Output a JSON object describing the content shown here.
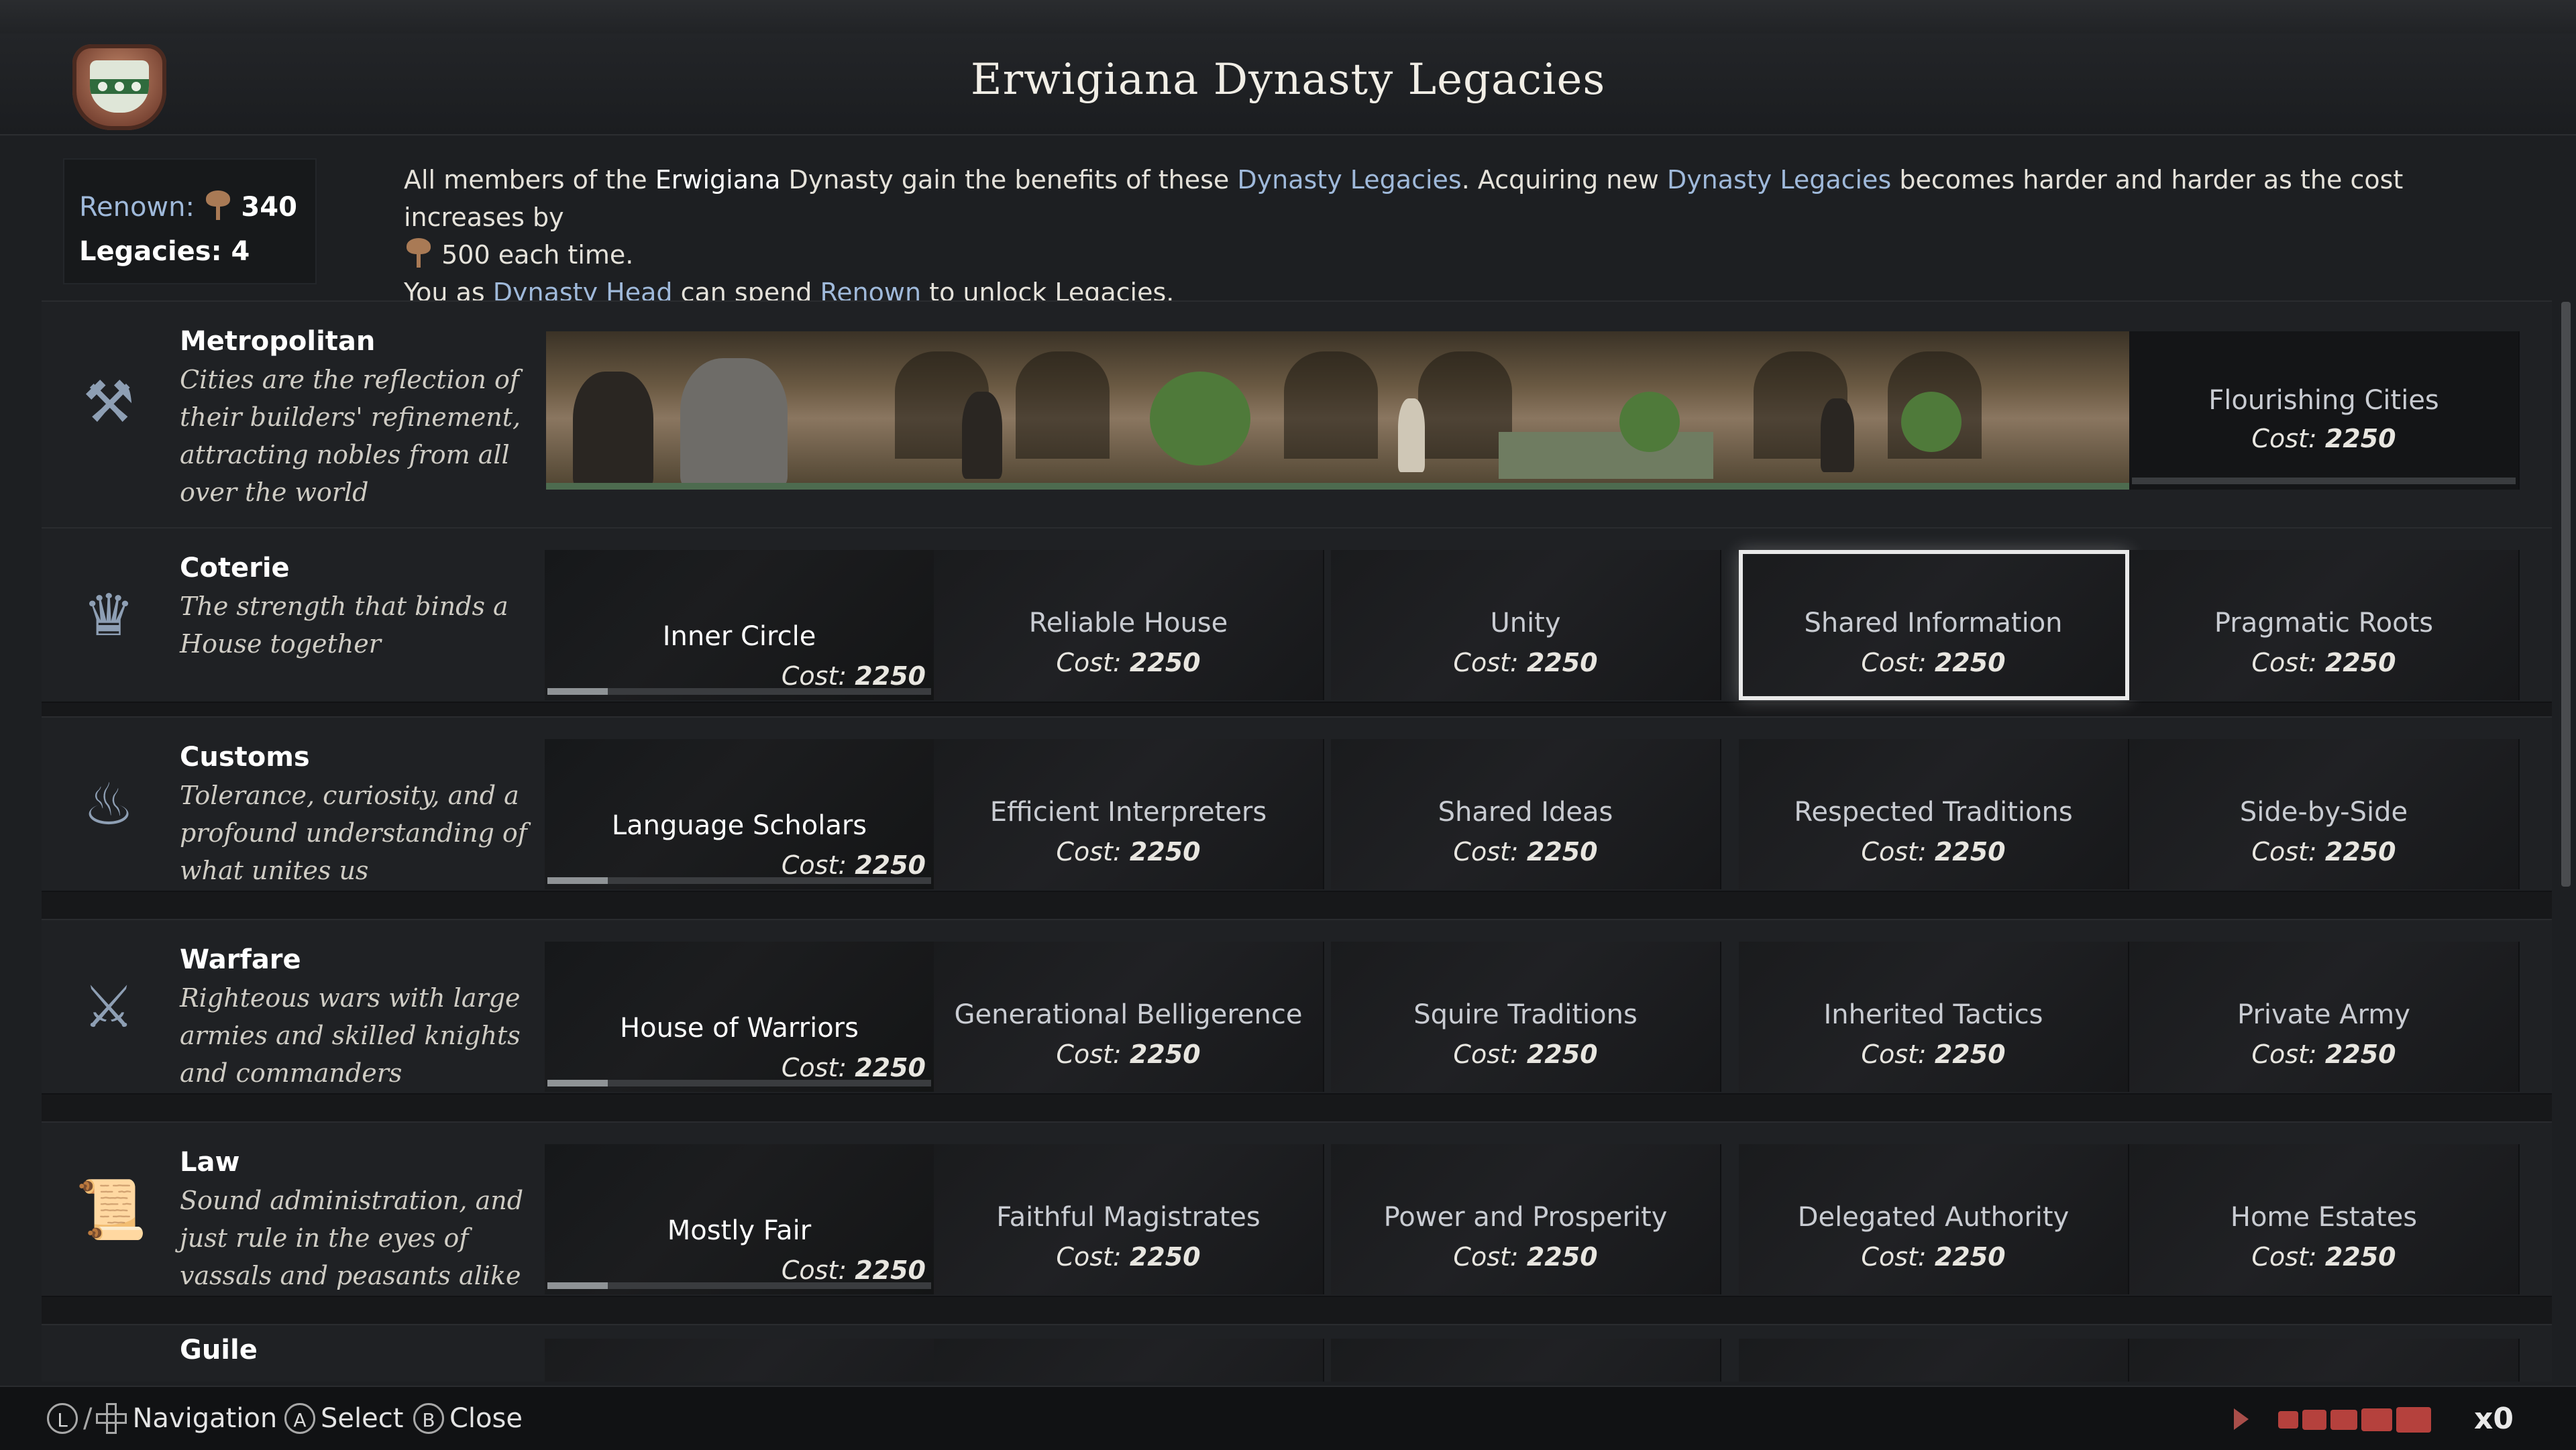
{
  "window": {
    "title": "Erwigiana Dynasty Legacies"
  },
  "summary": {
    "renown_label": "Renown:",
    "renown_value": "340",
    "legacies_text": "Legacies: 4"
  },
  "description": {
    "line1_a": "All members of the ",
    "line1_dynasty": "Erwigiana",
    "line1_b": " Dynasty gain the benefits of these ",
    "line1_link1": "Dynasty Legacies",
    "line1_c": ". Acquiring new ",
    "line1_link2": "Dynasty Legacies",
    "line1_d": " becomes harder and harder as the cost increases by",
    "line2": "500 each time.",
    "line3_a": "You as ",
    "line3_link1": "Dynasty Head",
    "line3_b": " can spend ",
    "line3_link2": "Renown",
    "line3_c": " to unlock Legacies."
  },
  "tracks": [
    {
      "name": "Metropolitan",
      "description": "Cities are the reflection of their builders' refinement, attracting nobles from all over the world",
      "icon": "hammer-icon",
      "legacies": [
        {
          "name": "Flourishing Cities",
          "cost_label": "Cost:",
          "cost": "2250"
        }
      ]
    },
    {
      "name": "Coterie",
      "description": "The strength that binds a House together",
      "icon": "crowns-icon",
      "legacies": [
        {
          "name": "Inner Circle",
          "cost_label": "Cost:",
          "cost": "2250"
        },
        {
          "name": "Reliable House",
          "cost_label": "Cost:",
          "cost": "2250"
        },
        {
          "name": "Unity",
          "cost_label": "Cost:",
          "cost": "2250"
        },
        {
          "name": "Shared Information",
          "cost_label": "Cost:",
          "cost": "2250"
        },
        {
          "name": "Pragmatic Roots",
          "cost_label": "Cost:",
          "cost": "2250"
        }
      ]
    },
    {
      "name": "Customs",
      "description": "Tolerance, curiosity, and a profound understanding of what unites us",
      "icon": "flame-icon",
      "legacies": [
        {
          "name": "Language Scholars",
          "cost_label": "Cost:",
          "cost": "2250"
        },
        {
          "name": "Efficient Interpreters",
          "cost_label": "Cost:",
          "cost": "2250"
        },
        {
          "name": "Shared Ideas",
          "cost_label": "Cost:",
          "cost": "2250"
        },
        {
          "name": "Respected Traditions",
          "cost_label": "Cost:",
          "cost": "2250"
        },
        {
          "name": "Side-by-Side",
          "cost_label": "Cost:",
          "cost": "2250"
        }
      ]
    },
    {
      "name": "Warfare",
      "description": "Righteous wars with large armies and skilled knights and commanders",
      "icon": "crossed-swords-icon",
      "legacies": [
        {
          "name": "House of Warriors",
          "cost_label": "Cost:",
          "cost": "2250"
        },
        {
          "name": "Generational Belligerence",
          "cost_label": "Cost:",
          "cost": "2250"
        },
        {
          "name": "Squire Traditions",
          "cost_label": "Cost:",
          "cost": "2250"
        },
        {
          "name": "Inherited Tactics",
          "cost_label": "Cost:",
          "cost": "2250"
        },
        {
          "name": "Private Army",
          "cost_label": "Cost:",
          "cost": "2250"
        }
      ]
    },
    {
      "name": "Law",
      "description": "Sound administration, and just rule in the eyes of vassals and peasants alike",
      "icon": "scroll-icon",
      "legacies": [
        {
          "name": "Mostly Fair",
          "cost_label": "Cost:",
          "cost": "2250"
        },
        {
          "name": "Faithful Magistrates",
          "cost_label": "Cost:",
          "cost": "2250"
        },
        {
          "name": "Power and Prosperity",
          "cost_label": "Cost:",
          "cost": "2250"
        },
        {
          "name": "Delegated Authority",
          "cost_label": "Cost:",
          "cost": "2250"
        },
        {
          "name": "Home Estates",
          "cost_label": "Cost:",
          "cost": "2250"
        }
      ]
    },
    {
      "name": "Guile",
      "description": "",
      "icon": "mask-icon",
      "legacies": []
    }
  ],
  "selected_legacy": "Shared Information",
  "controls": {
    "navigation": {
      "glyph": "L",
      "label": "Navigation"
    },
    "select": {
      "glyph": "A",
      "label": "Select"
    },
    "close": {
      "glyph": "B",
      "label": "Close"
    }
  },
  "game_speed": {
    "value": "x0"
  }
}
